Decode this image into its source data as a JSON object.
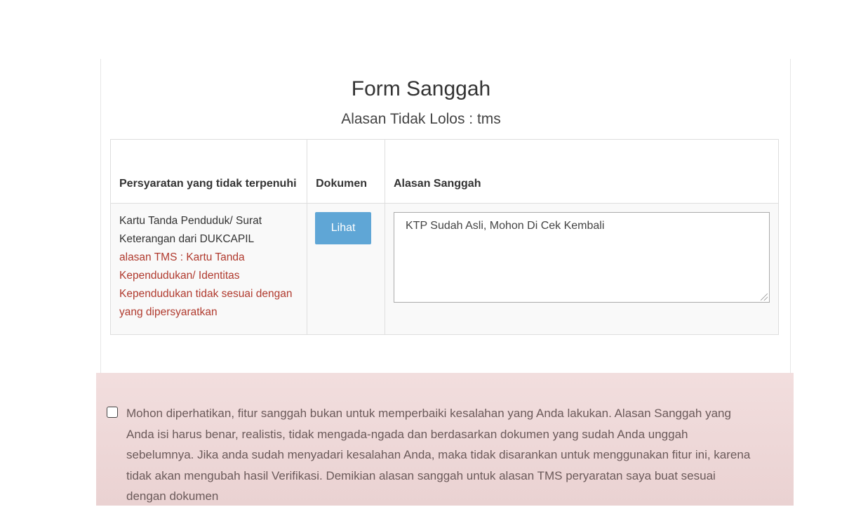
{
  "form": {
    "title": "Form Sanggah",
    "subtitle": "Alasan Tidak Lolos : tms"
  },
  "table": {
    "headers": {
      "requirement": "Persyaratan yang tidak terpenuhi",
      "document": "Dokumen",
      "reason": "Alasan Sanggah"
    },
    "rows": [
      {
        "requirement": "Kartu Tanda Penduduk/ Surat Keterangan dari DUKCAPIL",
        "tms_reason": "alasan TMS : Kartu Tanda Kependudukan/ Identitas Kependudukan tidak sesuai dengan yang dipersyaratkan",
        "document_button": "Lihat",
        "appeal_text": "KTP Sudah Asli, Mohon Di Cek Kembali"
      }
    ]
  },
  "notice": {
    "text": "Mohon diperhatikan, fitur sanggah bukan untuk memperbaiki kesalahan yang Anda lakukan. Alasan Sanggah yang Anda isi harus benar, realistis, tidak mengada-ngada dan berdasarkan dokumen yang sudah Anda unggah sebelumnya. Jika anda sudah menyadari kesalahan Anda, maka tidak disarankan untuk menggunakan fitur ini, karena tidak akan mengubah hasil Verifikasi. Demikian alasan sanggah untuk alasan TMS peryaratan saya buat sesuai dengan dokumen",
    "checked": false
  }
}
